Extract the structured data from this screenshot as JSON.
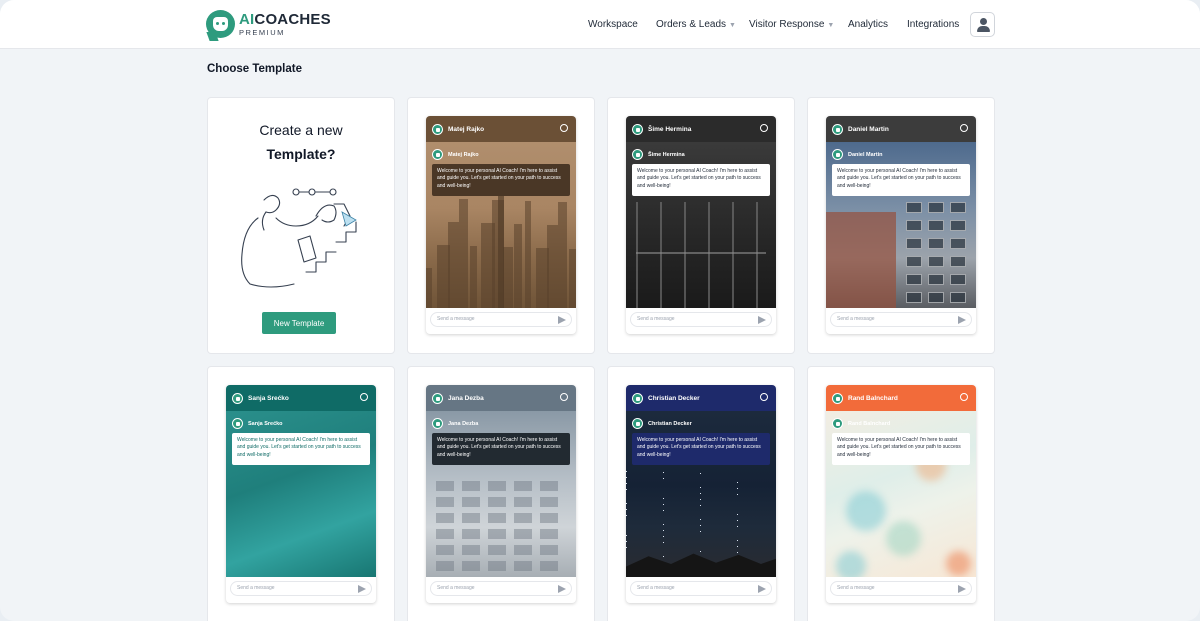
{
  "brand": {
    "name_accent": "AI",
    "name_rest": "COACHES",
    "tagline": "PREMIUM"
  },
  "nav": {
    "items": [
      {
        "label": "Workspace",
        "has_dropdown": false
      },
      {
        "label": "Orders & Leads",
        "has_dropdown": true
      },
      {
        "label": "Visitor Response",
        "has_dropdown": true
      },
      {
        "label": "Analytics",
        "has_dropdown": false
      },
      {
        "label": "Integrations",
        "has_dropdown": false
      }
    ],
    "profile_icon": "user-icon"
  },
  "page_title": "Choose Template",
  "create_card": {
    "line1": "Create a new",
    "line2": "Template?",
    "button_label": "New Template"
  },
  "templates": [
    {
      "name": "Matej Rajko",
      "header_color": "#6b5036",
      "text_color": "#ffffff",
      "message_bg": "#4a3726",
      "message_text_color": "#ffffff",
      "background": "city-skyline"
    },
    {
      "name": "Šime Hermina",
      "header_color": "#2b2b2b",
      "text_color": "#ffffff",
      "message_bg": "#ffffff",
      "message_text_color": "#1f2937",
      "background": "gym"
    },
    {
      "name": "Daniel Martin",
      "header_color": "#3c3c3c",
      "text_color": "#ffffff",
      "message_bg": "#ffffff",
      "message_text_color": "#1f2937",
      "background": "building"
    },
    {
      "name": "Sanja Srećko",
      "header_color": "#0f6b66",
      "text_color": "#ffffff",
      "message_bg": "#ffffff",
      "message_text_color": "#0f6b66",
      "background": "sea"
    },
    {
      "name": "Jana Dezba",
      "header_color": "#667684",
      "text_color": "#ffffff",
      "message_bg": "#222a31",
      "message_text_color": "#ffffff",
      "background": "white-building"
    },
    {
      "name": "Christian Decker",
      "header_color": "#1e2a6b",
      "text_color": "#ffffff",
      "message_bg": "#1e2a6b",
      "message_text_color": "#ffffff",
      "background": "night-sky"
    },
    {
      "name": "Rand Balnchard",
      "header_color": "#f26b3a",
      "text_color": "#ffffff",
      "message_bg": "#ffffff",
      "message_text_color": "#1f2937",
      "background": "paint"
    }
  ],
  "template_message": "Welcome to your personal AI Coach! I'm here to assist and guide you. Let's get started on your path to success and well-being!",
  "input_placeholder": "Send a message",
  "accent_color": "#2e9b7e"
}
